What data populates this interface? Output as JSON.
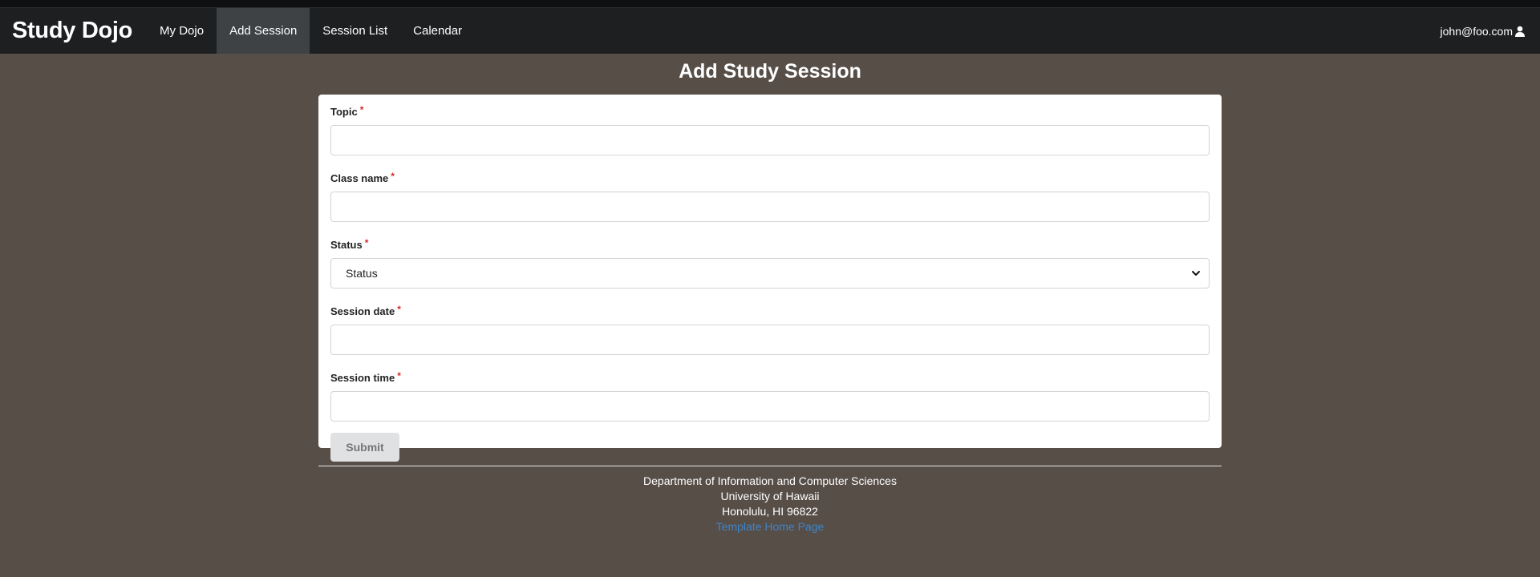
{
  "navbar": {
    "brand": "Study Dojo",
    "items": [
      {
        "label": "My Dojo"
      },
      {
        "label": "Add Session"
      },
      {
        "label": "Session List"
      },
      {
        "label": "Calendar"
      }
    ],
    "user": "john@foo.com",
    "user_icon": "user-icon"
  },
  "page": {
    "title": "Add Study Session"
  },
  "form": {
    "topic_label": "Topic",
    "class_label": "Class name",
    "status_label": "Status",
    "status_selected": "Status",
    "date_label": "Session date",
    "time_label": "Session time",
    "required_marker": "*",
    "submit_label": "Submit"
  },
  "footer": {
    "line1": "Department of Information and Computer Sciences",
    "line2": "University of Hawaii",
    "line3": "Honolulu, HI 96822",
    "link": "Template Home Page"
  },
  "colors": {
    "background": "#574e48",
    "navbar": "#1d1f21",
    "active_nav": "#3e4245",
    "required": "#db2828",
    "link": "#4183c4"
  }
}
